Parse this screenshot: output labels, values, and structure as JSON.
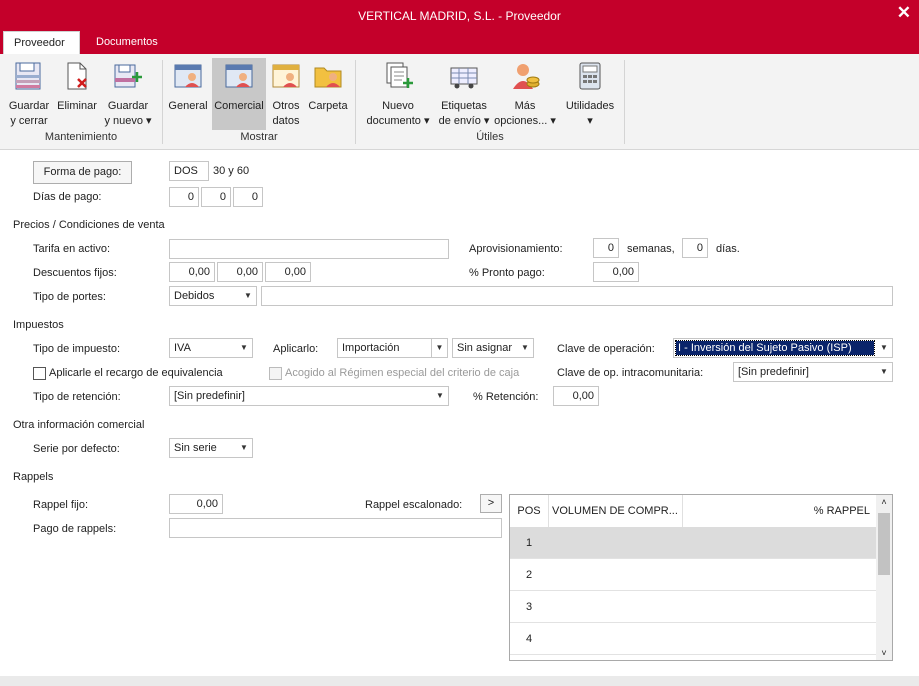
{
  "window": {
    "title": "VERTICAL MADRID, S.L. - Proveedor",
    "close_glyph": "✕"
  },
  "tabs": [
    {
      "label": "Proveedor"
    },
    {
      "label": "Documentos"
    }
  ],
  "ribbon": {
    "guardar_cerrar": [
      "Guardar",
      "y cerrar"
    ],
    "eliminar": "Eliminar",
    "guardar_nuevo": [
      "Guardar",
      "y nuevo ▾"
    ],
    "general": "General",
    "comercial": "Comercial",
    "otros_datos": [
      "Otros",
      "datos"
    ],
    "carpeta": "Carpeta",
    "nuevo_documento": [
      "Nuevo",
      "documento ▾"
    ],
    "etiquetas": [
      "Etiquetas",
      "de envío ▾"
    ],
    "mas_opciones": [
      "Más",
      "opciones... ▾"
    ],
    "utilidades": [
      "Utilidades",
      "▾"
    ],
    "groups": {
      "mantenimiento": "Mantenimiento",
      "mostrar": "Mostrar",
      "utiles": "Útiles"
    }
  },
  "pago": {
    "forma_button": "Forma de pago:",
    "forma_code": "DOS",
    "forma_desc": "30 y 60",
    "dias_label": "Días de pago:",
    "dias": [
      "0",
      "0",
      "0"
    ]
  },
  "precios": {
    "section": "Precios / Condiciones de venta",
    "tarifa_label": "Tarifa en activo:",
    "tarifa_value": "",
    "descuentos_label": "Descuentos fijos:",
    "descuentos": [
      "0,00",
      "0,00",
      "0,00"
    ],
    "portes_label": "Tipo de portes:",
    "portes_value": "Debidos",
    "portes_extra": "",
    "aprov_label": "Aprovisionamiento:",
    "aprov_semanas": "0",
    "semanas_label": "semanas,",
    "aprov_dias": "0",
    "dias_label": "días.",
    "pronto_label": "% Pronto pago:",
    "pronto_value": "0,00"
  },
  "impuestos": {
    "section": "Impuestos",
    "tipo_label": "Tipo de impuesto:",
    "tipo_value": "IVA",
    "aplicarlo_label": "Aplicarlo:",
    "aplicarlo_value": "Importación",
    "sin_asignar": "Sin asignar",
    "clave_label": "Clave de operación:",
    "clave_value": "I - Inversión del Sujeto Pasivo (ISP)",
    "recargo_label": "Aplicarle el recargo de equivalencia",
    "acogido_label": "Acogido al Régimen especial del criterio de caja",
    "clave_intra_label": "Clave de op. intracomunitaria:",
    "clave_intra_value": "[Sin predefinir]",
    "retencion_label": "Tipo de retención:",
    "retencion_value": "[Sin predefinir]",
    "pct_retencion_label": "% Retención:",
    "pct_retencion_value": "0,00"
  },
  "otra": {
    "section": "Otra información comercial",
    "serie_label": "Serie por defecto:",
    "serie_value": "Sin serie"
  },
  "rappels": {
    "section": "Rappels",
    "fijo_label": "Rappel fijo:",
    "fijo_value": "0,00",
    "escalonado_label": "Rappel escalonado:",
    "escalonado_btn": ">",
    "pago_label": "Pago de rappels:",
    "pago_value": "",
    "grid": {
      "headers": [
        "POS",
        "VOLUMEN DE COMPR...",
        "% RAPPEL"
      ],
      "rows": [
        "1",
        "2",
        "3",
        "4"
      ]
    }
  },
  "colors": {
    "accent": "#c4002a",
    "selection": "#0a246a"
  },
  "icons": [
    "save-close-icon",
    "delete-icon",
    "save-new-icon",
    "general-icon",
    "comercial-icon",
    "otros-datos-icon",
    "carpeta-icon",
    "nuevo-documento-icon",
    "etiquetas-icon",
    "mas-opciones-icon",
    "utilidades-icon"
  ]
}
